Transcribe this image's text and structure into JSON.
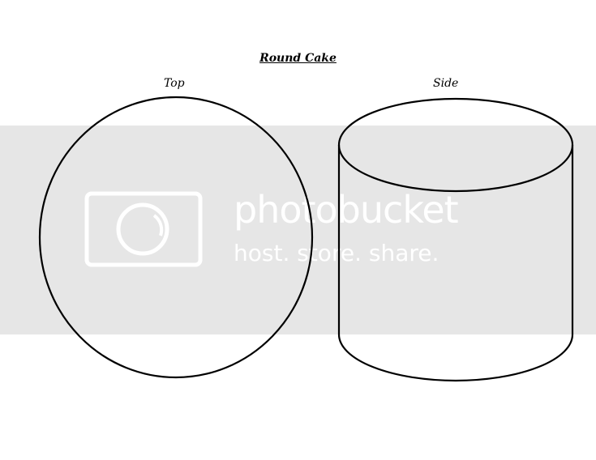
{
  "title": "Round Cake",
  "labels": {
    "top": "Top",
    "side": "Side"
  },
  "watermark": {
    "line1": "photobucket",
    "line2": "host. store. share."
  }
}
